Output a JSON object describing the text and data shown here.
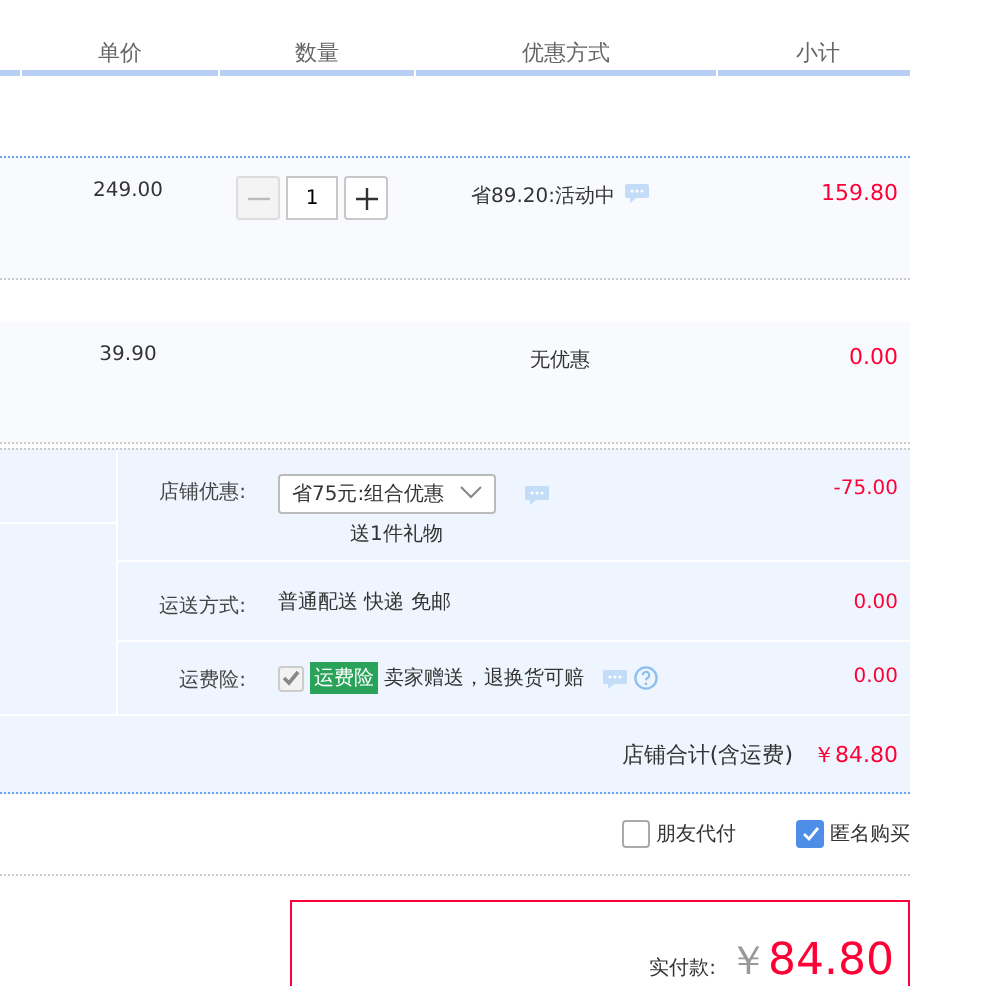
{
  "columns": [
    "单价",
    "数量",
    "优惠方式",
    "小计"
  ],
  "items": [
    {
      "unit_price": "249.00",
      "quantity": {
        "value": "1",
        "minus_disabled": true
      },
      "discount": "省89.20:活动中",
      "discount_info": true,
      "subtotal": "159.80"
    },
    {
      "unit_price": "39.90",
      "discount": "无优惠",
      "discount_info": false,
      "subtotal": "0.00"
    }
  ],
  "store": {
    "rows": [
      {
        "kind": "select",
        "label": "店铺优惠:",
        "value": "省75元:组合优惠",
        "note": "送1件礼物",
        "info": true,
        "amount": "-75.00"
      },
      {
        "kind": "text",
        "label": "运送方式:",
        "value": "普通配送 快递 免邮",
        "amount": "0.00"
      },
      {
        "kind": "insurance",
        "label": "运费险:",
        "checked": true,
        "disabled": true,
        "tag": "运费险",
        "value": "卖家赠送，退换货可赔",
        "info": true,
        "amount": "0.00"
      }
    ],
    "total_label": "店铺合计(含运费)",
    "total": "￥84.80"
  },
  "options": [
    {
      "label": "朋友代付",
      "checked": false
    },
    {
      "label": "匿名购买",
      "checked": true
    }
  ],
  "payment": {
    "label": "实付款:",
    "currency": "￥",
    "amount": "84.80"
  }
}
